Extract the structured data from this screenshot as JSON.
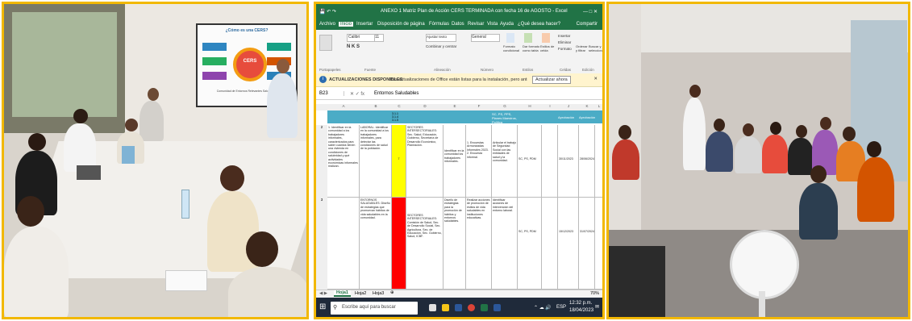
{
  "excel": {
    "title": "ANEXO 1 Matriz Plan de Acción CERS TERMINADA con fecha 16 de AGOSTO - Excel",
    "menu_tabs": [
      "Archivo",
      "Inicio",
      "Insertar",
      "Disposición de página",
      "Fórmulas",
      "Datos",
      "Revisar",
      "Vista",
      "Ayuda",
      "¿Qué desea hacer?"
    ],
    "share_label": "Compartir",
    "font_name": "Calibri",
    "font_size": "11",
    "wrap_label": "Ajustar texto",
    "merge_label": "Combinar y centrar",
    "number_format": "General",
    "format_table_label": "Dar formato como tabla",
    "cell_styles_label": "Estilos de celda",
    "conditional_label": "Formato condicional",
    "insert_label": "Insertar",
    "delete_label": "Eliminar",
    "format_label": "Formato",
    "sort_label": "Ordenar y filtrar",
    "find_label": "Buscar y seleccionar",
    "groups": [
      "Portapapeles",
      "Fuente",
      "Alineación",
      "Número",
      "Estilos",
      "Celdas",
      "Edición"
    ],
    "info_title": "ACTUALIZACIONES DISPONIBLES",
    "info_text": "Las actualizaciones de Office están listas para la instalación, pero antes tenemos que cerrar algunas aplicaciones.",
    "info_button": "Actualizar ahora",
    "name_box": "B23",
    "formula": "Entornos Saludables",
    "columns": [
      "A",
      "B",
      "C",
      "D",
      "E",
      "F",
      "G",
      "H",
      "I",
      "J",
      "K",
      "L"
    ],
    "header_cells": [
      "SC, PS, PPS, Planes Maestros, Política",
      "Aprobación",
      "Aprobación"
    ],
    "row_numbers": [
      "1",
      "2",
      "3"
    ],
    "row1_code": "3.1.1\n3.1.4\n3.1.5",
    "row1_num": "7",
    "row1_text_a": "1. Identificar en la comunidad a los trabajadores informales, caracterizados para saber cuántos tienen una vivienda en condiciones de salubridad y qué actividades económicas informales realizan.",
    "row1_text_b": "LABORAL. Identificar en la comunidad a los trabajadores informales, para detectar las condiciones de salud de la población.",
    "row1_text_c": "SECTORES INTERSECTORIALES: Sec. Salud, Educación, Gobierno, Secretaría de Desarrollo Económico, Planeación.",
    "row1_text_d": "Identificar en la comunidad los trabajadores informales.",
    "row1_text_e": "1. Encuestas Armonizadas Informales 2023. 2. Encuesta informal.",
    "row1_text_f": "Articular el trabajo de Seguridad Social con las entidades de salud y la comunidad.",
    "row1_ref": "SC, PS, PDM",
    "row1_date1": "30/11/2023",
    "row1_date2": "28/06/2024",
    "row2_text_c": "SECTORES INTERSECTORIALES: Comisión de Salud, Sec. de Desarrollo Social, Sec. Agricultura, Sec. de Educación, Sec. Gobierno, Salud, ICBF.",
    "row2_text_b": "ENTORNOS SALUDABLES: Diseño de estrategias que promuevan hábitos de vida saludables en la comunidad.",
    "row2_text_d": "Diseño de estrategias para la promoción de hábitos y entornos saludables.",
    "row2_text_e": "Realizar acciones de promoción de estilos de vida saludables en instituciones educativas.",
    "row2_text_f": "Identificar acciones de intervención del entorno laboral.",
    "row2_ref": "SC, PS, PDM",
    "row2_date1": "15/12/2023",
    "row2_date2": "31/07/2024",
    "sheet_tabs": [
      "Hoja1",
      "Hoja2",
      "Hoja3"
    ],
    "zoom": "70%",
    "search_placeholder": "Escribe aquí para buscar",
    "clock_time": "12:32 p.m.",
    "clock_date": "18/04/2023",
    "lang": "ESP"
  },
  "photo1": {
    "screen_title": "¿Cómo es una CERS?",
    "screen_center": "CERS",
    "screen_subtitle": "Comunidad de Entornos Relevantes Saludables"
  },
  "colors": {
    "frame": "#f2b800",
    "excel_green": "#217346",
    "header_teal": "#4bacc6",
    "highlight_yellow": "#ffff00",
    "highlight_red": "#ff0000"
  }
}
